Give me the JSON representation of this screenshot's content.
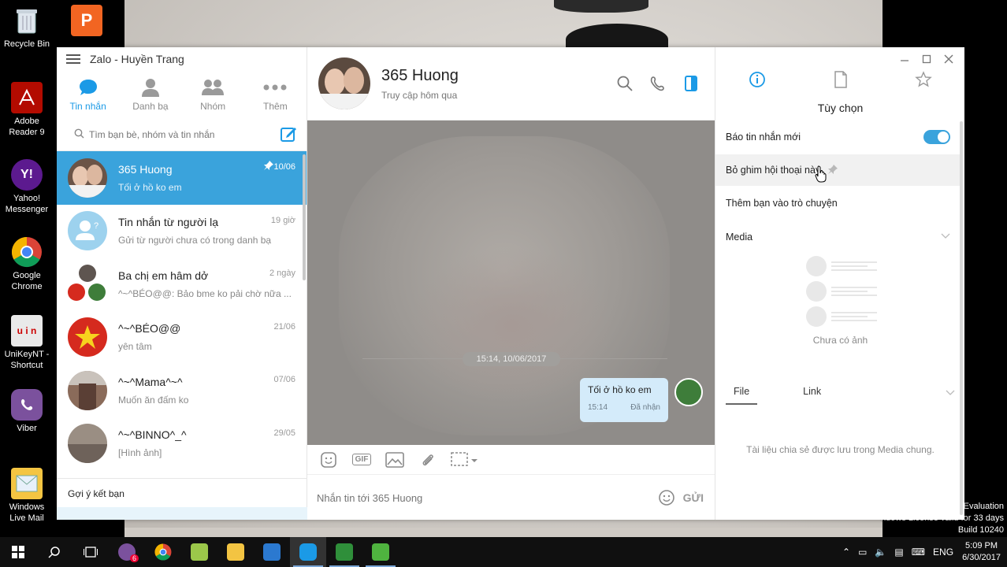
{
  "desktop": {
    "icons": [
      {
        "label": "Recycle Bin"
      },
      {
        "label": "Adobe Reader 9"
      },
      {
        "label": "Yahoo! Messenger"
      },
      {
        "label": "Google Chrome"
      },
      {
        "label": "UniKeyNT - Shortcut"
      },
      {
        "label": "Viber"
      },
      {
        "label": "Windows Live Mail"
      }
    ],
    "watermark": [
      "Evaluation",
      "ndows License valid for 33 days",
      "Build 10240"
    ]
  },
  "taskbar": {
    "language": "ENG",
    "time": "5:09 PM",
    "date": "6/30/2017",
    "viber_badge": "6"
  },
  "app": {
    "title": "Zalo - Huyền Trang"
  },
  "nav": {
    "tabs": [
      {
        "label": "Tin nhắn"
      },
      {
        "label": "Danh bạ"
      },
      {
        "label": "Nhóm"
      },
      {
        "label": "Thêm"
      }
    ]
  },
  "search": {
    "placeholder": "Tìm bạn bè, nhóm và tin nhắn"
  },
  "conversations": [
    {
      "name": "365 Huong",
      "preview": "Tối ở hồ ko em",
      "time": "10/06"
    },
    {
      "name": "Tin nhắn từ người lạ",
      "preview": "Gửi từ người chưa có trong danh bạ",
      "time": "19 giờ"
    },
    {
      "name": "Ba chị em hâm dở",
      "preview": "^~^BÉO@@: Bảo bme ko pải chờ nữa ...",
      "time": "2 ngày"
    },
    {
      "name": "^~^BÉO@@",
      "preview": "yên tâm",
      "time": "21/06"
    },
    {
      "name": "^~^Mama^~^",
      "preview": "Muốn ăn đấm ko",
      "time": "07/06"
    },
    {
      "name": "^~^BINNO^_^",
      "preview": "[Hình ảnh]",
      "time": "29/05"
    }
  ],
  "suggest": {
    "label": "Gợi ý kết bạn"
  },
  "chat": {
    "name": "365 Huong",
    "status": "Truy cập hôm qua",
    "date_chip": "15:14, 10/06/2017",
    "message": {
      "text": "Tối ở hồ ko em",
      "time": "15:14",
      "status": "Đã nhận"
    },
    "toolbar": {
      "gif": "GIF"
    },
    "input_placeholder": "Nhắn tin tới 365 Huong",
    "send_label": "GỬI"
  },
  "options": {
    "title": "Tùy chọn",
    "notify": "Báo tin nhắn mới",
    "notify_on": true,
    "unpin": "Bỏ ghim hội thoại này",
    "add_friend": "Thêm bạn vào trò chuyện",
    "media": "Media",
    "no_media": "Chưa có ảnh",
    "file_tab": "File",
    "link_tab": "Link",
    "file_note": "Tài liệu chia sẻ được lưu trong Media chung."
  },
  "colors": {
    "accent": "#3aa3dc",
    "tab_active": "#1b9ae6",
    "bubble": "#d4ebfa"
  }
}
